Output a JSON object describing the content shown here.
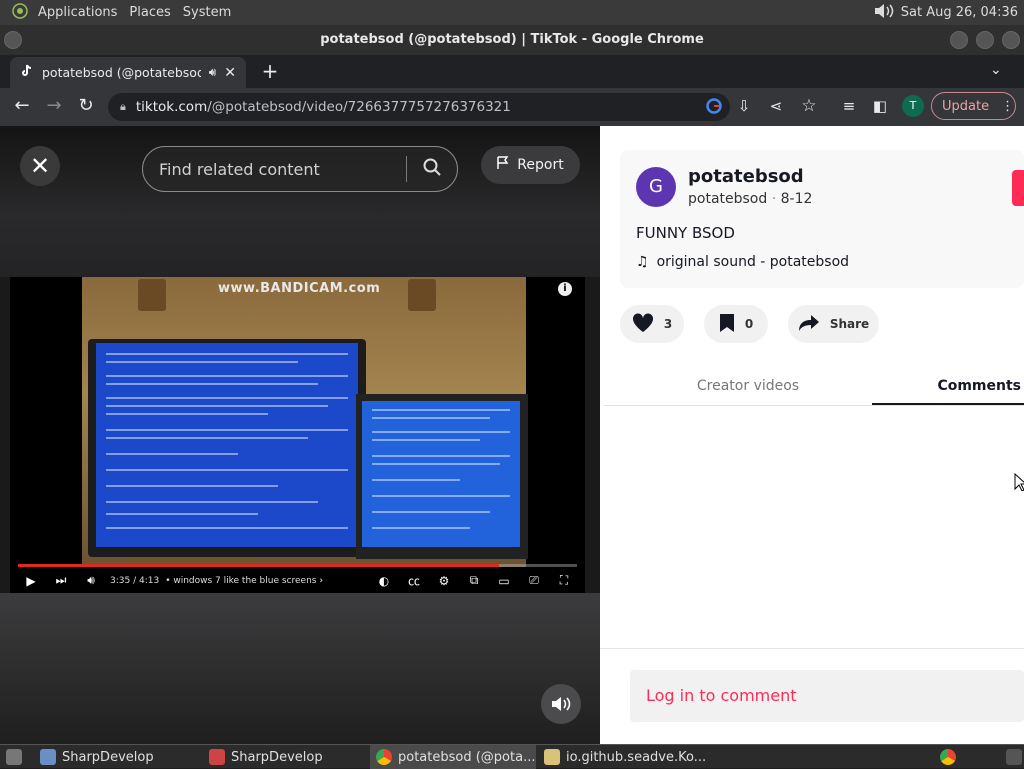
{
  "top_panel": {
    "menus": [
      "Applications",
      "Places",
      "System"
    ],
    "clock": "Sat Aug 26, 04:36"
  },
  "window": {
    "title": "potatebsod (@potatebsod) | TikTok - Google Chrome"
  },
  "tab": {
    "title": "potatebsod (@potatebsod",
    "new_tab": "+"
  },
  "address_bar": {
    "domain": "tiktok.com",
    "path": "/@potatebsod/video/7266377757276376321"
  },
  "toolbar": {
    "profile_initial": "T",
    "update_label": "Update"
  },
  "video": {
    "search_placeholder": "Find related content",
    "report_label": "Report",
    "watermark": "www.BANDICAM.com",
    "time": "3:35 / 4:13",
    "chapter": "• windows 7 like the blue screens",
    "progress": 0.86
  },
  "profile": {
    "avatar_initial": "G",
    "username": "potatebsod",
    "handle": "potatebsod",
    "date": "8-12",
    "caption": "FUNNY BSOD",
    "music": "original sound - potatebsod"
  },
  "actions": {
    "likes": "3",
    "bookmarks": "0",
    "share_label": "Share"
  },
  "tabs": {
    "creator": "Creator videos",
    "comments": "Comments"
  },
  "login": {
    "label": "Log in to comment"
  },
  "taskbar": {
    "items": [
      "SharpDevelop",
      "SharpDevelop",
      "potatebsod (@pota...",
      "io.github.seadve.Ko..."
    ]
  }
}
